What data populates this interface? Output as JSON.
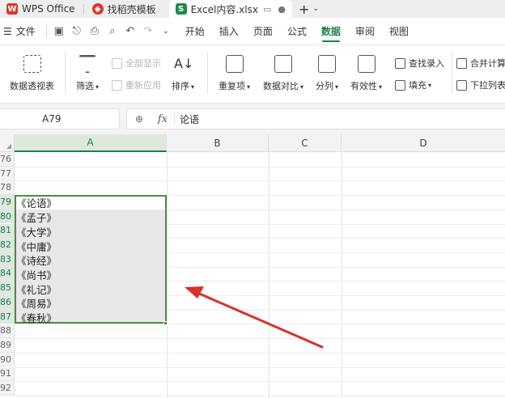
{
  "tabs": [
    {
      "label": "WPS Office",
      "icon": "wps-logo-icon",
      "color": "#e0362c"
    },
    {
      "label": "找稻壳模板",
      "icon": "docer-logo-icon",
      "color": "#e0362c"
    },
    {
      "label": "Excel内容.xlsx",
      "icon": "sheet-file-icon",
      "color": "#1e8a4c",
      "active": true
    }
  ],
  "menu": {
    "file": "文件",
    "items": [
      "开始",
      "插入",
      "页面",
      "公式",
      "数据",
      "审阅",
      "视图"
    ],
    "active": "数据"
  },
  "ribbon": {
    "pivot": "数据透视表",
    "filter": "筛选",
    "show_all": "全部显示",
    "reapply": "重新应用",
    "sort": "排序",
    "duplicates": "重复项",
    "compare": "数据对比",
    "split": "分列",
    "validity": "有效性",
    "find_entry": "查找录入",
    "fill": "填充",
    "merge_calc": "合并计算",
    "dropdown_list": "下拉列表"
  },
  "formula_bar": {
    "cell_ref": "A79",
    "fx_label": "fx",
    "value": "论语"
  },
  "columns": [
    "A",
    "B",
    "C",
    "D"
  ],
  "rows": [
    {
      "num": "76",
      "a": ""
    },
    {
      "num": "77",
      "a": ""
    },
    {
      "num": "78",
      "a": ""
    },
    {
      "num": "79",
      "a": "《论语》"
    },
    {
      "num": "80",
      "a": "《孟子》"
    },
    {
      "num": "81",
      "a": "《大学》"
    },
    {
      "num": "82",
      "a": "《中庸》"
    },
    {
      "num": "83",
      "a": "《诗经》"
    },
    {
      "num": "84",
      "a": "《尚书》"
    },
    {
      "num": "85",
      "a": "《礼记》"
    },
    {
      "num": "86",
      "a": "《周易》"
    },
    {
      "num": "87",
      "a": "《春秋》"
    },
    {
      "num": "88",
      "a": ""
    },
    {
      "num": "89",
      "a": ""
    },
    {
      "num": "90",
      "a": ""
    },
    {
      "num": "91",
      "a": ""
    },
    {
      "num": "92",
      "a": ""
    }
  ],
  "colors": {
    "accent": "#1a7f4b",
    "selection_border": "#4a8f3a",
    "annotation_arrow": "#d9312b"
  }
}
